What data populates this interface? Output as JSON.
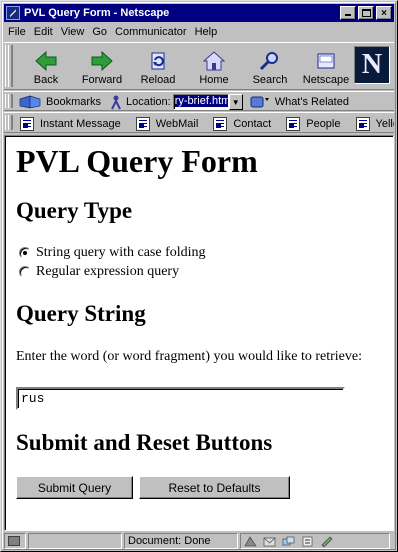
{
  "window": {
    "title": "PVL Query Form - Netscape",
    "minimize_label": "",
    "maximize_label": "",
    "close_label": "×"
  },
  "menu": [
    {
      "label": "File"
    },
    {
      "label": "Edit"
    },
    {
      "label": "View"
    },
    {
      "label": "Go"
    },
    {
      "label": "Communicator"
    },
    {
      "label": "Help"
    }
  ],
  "nav_toolbar": {
    "buttons": [
      {
        "label": "Back",
        "icon": "back-arrow-icon"
      },
      {
        "label": "Forward",
        "icon": "forward-arrow-icon"
      },
      {
        "label": "Reload",
        "icon": "reload-icon"
      },
      {
        "label": "Home",
        "icon": "home-icon"
      },
      {
        "label": "Search",
        "icon": "search-icon"
      },
      {
        "label": "Netscape",
        "icon": "netscape-my-icon"
      }
    ],
    "logo_letter": "N"
  },
  "location_bar": {
    "bookmarks_label": "Bookmarks",
    "location_label": "Location:",
    "url_value": "ry-brief.htm",
    "whats_related_label": "What's Related"
  },
  "personal_toolbar": {
    "items": [
      {
        "label": "Instant Message"
      },
      {
        "label": "WebMail"
      },
      {
        "label": "Contact"
      },
      {
        "label": "People"
      },
      {
        "label": "Yello"
      }
    ]
  },
  "page": {
    "heading": "PVL Query Form",
    "query_type_heading": "Query Type",
    "radio_options": [
      {
        "label": "String query with case folding",
        "checked": true
      },
      {
        "label": "Regular expression query",
        "checked": false
      }
    ],
    "query_string_heading": "Query String",
    "query_prompt": "Enter the word (or word fragment) you would like to retrieve:",
    "query_value": "rus",
    "buttons_heading": "Submit and Reset Buttons",
    "submit_label": "Submit Query",
    "reset_label": "Reset to Defaults"
  },
  "status_bar": {
    "status_text": "Document: Done"
  }
}
